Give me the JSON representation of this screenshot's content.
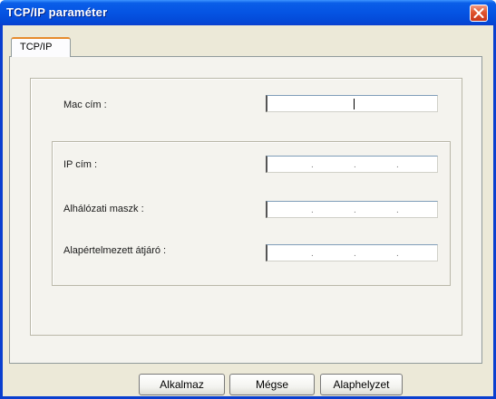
{
  "window": {
    "title": "TCP/IP paraméter"
  },
  "tabs": [
    {
      "label": "TCP/IP",
      "active": true
    }
  ],
  "fields": {
    "mac": {
      "label": "Mac cím :",
      "value": ""
    },
    "ip": {
      "label": "IP cím :",
      "separators": [
        ".",
        ".",
        "."
      ]
    },
    "subnet": {
      "label": "Alhálózati maszk :",
      "separators": [
        ".",
        ".",
        "."
      ]
    },
    "gateway": {
      "label": "Alapértelmezett átjáró :",
      "separators": [
        ".",
        ".",
        "."
      ]
    }
  },
  "buttons": {
    "apply": "Alkalmaz",
    "cancel": "Mégse",
    "default": "Alaphelyzet"
  },
  "icons": {
    "close": "close-icon"
  },
  "colors": {
    "titlebar": "#0554e3",
    "close_button": "#e0542e",
    "tab_highlight": "#e68b2c",
    "window_bg": "#ece9d8"
  }
}
